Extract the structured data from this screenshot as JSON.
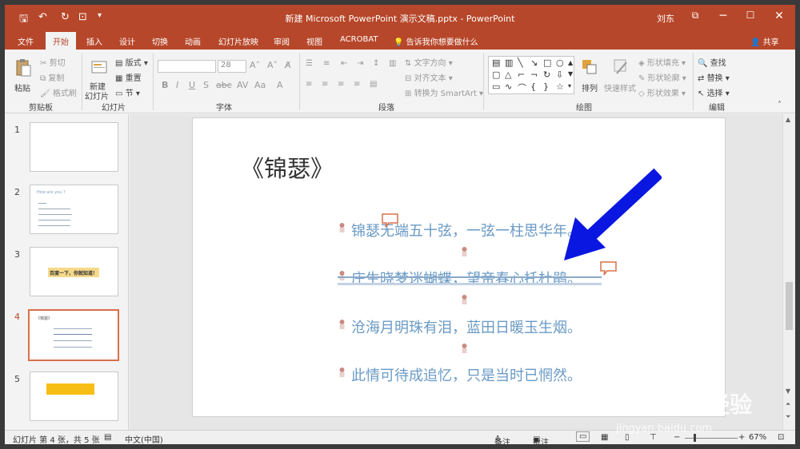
{
  "titlebar": {
    "title": "新建 Microsoft PowerPoint 演示文稿.pptx  -  PowerPoint",
    "user": "刘东",
    "minimize": "─",
    "maximize": "☐",
    "close": "✕",
    "restore": "⧉"
  },
  "tabs": [
    "文件",
    "开始",
    "插入",
    "设计",
    "切换",
    "动画",
    "幻灯片放映",
    "审阅",
    "视图",
    "ACROBAT"
  ],
  "tell_me": "告诉我你想要做什么",
  "share": "共享",
  "ribbon": {
    "clipboard": {
      "paste": "粘贴",
      "cut": "剪切",
      "copy": "复制",
      "format_painter": "格式刷",
      "label": "剪贴板"
    },
    "slides": {
      "new_slide_line1": "新建",
      "new_slide_line2": "幻灯片",
      "layout": "版式",
      "reset": "重置",
      "section": "节",
      "label": "幻灯片"
    },
    "font": {
      "font_name": "",
      "font_size": "28",
      "label": "字体"
    },
    "paragraph": {
      "text_direction": "文字方向",
      "align_text": "对齐文本",
      "smartart": "转换为 SmartArt",
      "label": "段落"
    },
    "drawing": {
      "arrange": "排列",
      "quick_styles": "快速样式",
      "shape_fill": "形状填充",
      "shape_outline": "形状轮廓",
      "shape_effects": "形状效果",
      "label": "绘图"
    },
    "editing": {
      "find": "查找",
      "replace": "替换",
      "select": "选择",
      "label": "编辑"
    }
  },
  "thumbnails": [
    {
      "num": "1"
    },
    {
      "num": "2",
      "title": "How are you ?"
    },
    {
      "num": "3",
      "text": "百度一下，你就知道！"
    },
    {
      "num": "4",
      "title": "《锦瑟》"
    },
    {
      "num": "5"
    }
  ],
  "slide": {
    "title": "《锦瑟》",
    "lines": [
      "锦瑟无端五十弦，一弦一柱思华年。",
      "庄生晓梦迷蝴蝶，望帝春心托杜鹃。",
      "沧海月明珠有泪，蓝田日暖玉生烟。",
      "此情可待成追忆，只是当时已惘然。"
    ]
  },
  "status": {
    "slide_info": "幻灯片 第 4 张，共 5 张",
    "language": "中文(中国)",
    "notes": "备注",
    "comments": "批注",
    "zoom": "67%"
  },
  "watermark": {
    "brand": "Baidu经验",
    "url": "jingyan.baidu.com"
  },
  "colors": {
    "accent": "#b7472a",
    "arrow": "#0a17e0",
    "text_line": "#6a9ac6"
  }
}
